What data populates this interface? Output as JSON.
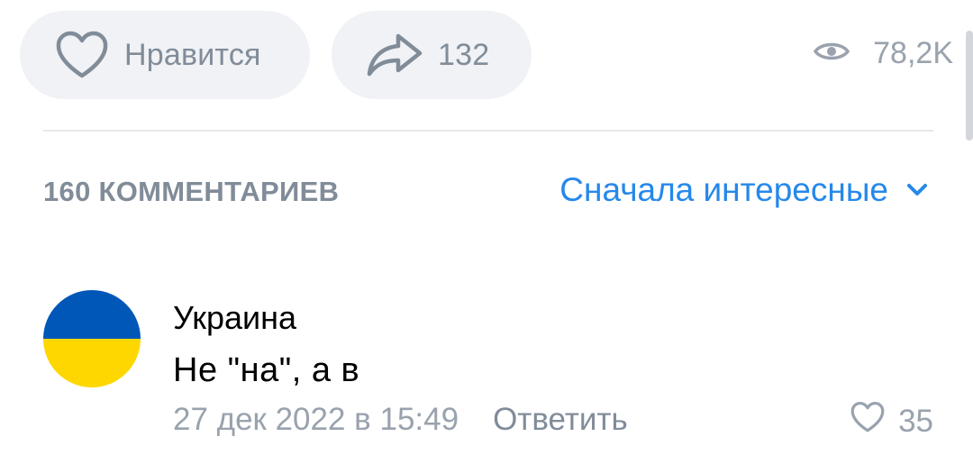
{
  "actions": {
    "like_label": "Нравится",
    "share_count": "132",
    "views_count": "78,2K"
  },
  "comments": {
    "count_label": "160 КОММЕНТАРИЕВ",
    "sort_label": "Сначала интересные",
    "items": [
      {
        "author": "Украина",
        "text": "Не \"на\", а в",
        "date": "27 дек 2022 в 15:49",
        "reply_label": "Ответить",
        "likes": "35",
        "avatar_colors": [
          "#0057b8",
          "#ffd700"
        ]
      }
    ]
  },
  "colors": {
    "accent": "#2688eb",
    "secondary_text": "#818c99",
    "pill_background": "#f0f2f5"
  },
  "icons": {
    "like": "heart-icon",
    "share": "share-arrow-icon",
    "views": "eye-icon",
    "sort": "chevron-down-icon"
  }
}
